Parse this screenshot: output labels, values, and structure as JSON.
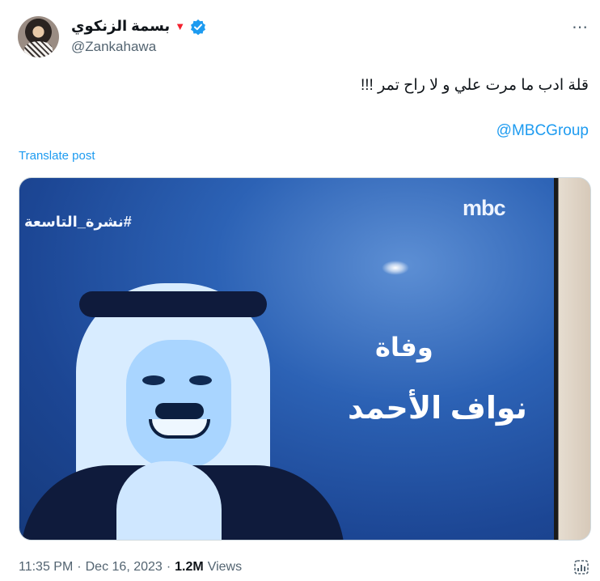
{
  "author": {
    "display_name": "بسمة الزنكوي",
    "handle": "@Zankahawa",
    "verified": true,
    "badge_icon": "heart-icon",
    "badge_color": "#f4212e",
    "verified_color": "#1d9bf0"
  },
  "menu": {
    "more_icon": "⋯"
  },
  "post": {
    "text": "قلة ادب ما مرت علي و لا راح تمر !!!",
    "mention": "@MBCGroup",
    "translate_label": "Translate post"
  },
  "media": {
    "hashtag_overlay": "#نشرة_التاسعة",
    "channel_logo": "mbc",
    "caption_line1": "وفاة",
    "caption_line2": "نواف الأحمد"
  },
  "meta": {
    "time": "11:35 PM",
    "separator": "·",
    "date": "Dec 16, 2023",
    "views_count": "1.2M",
    "views_label": "Views"
  },
  "colors": {
    "link": "#1d9bf0",
    "secondary_text": "#536471",
    "primary_text": "#0f1419"
  }
}
